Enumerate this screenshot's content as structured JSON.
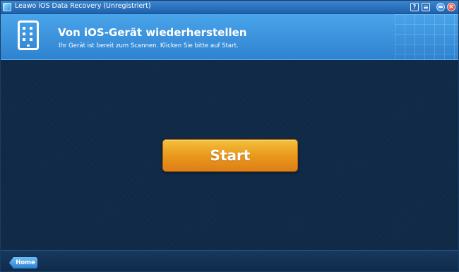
{
  "window": {
    "title": "Leawo iOS Data Recovery (Unregistriert)",
    "controls": {
      "help_label": "?",
      "close_label": "×"
    }
  },
  "header": {
    "title": "Von iOS-Gerät wiederherstellen",
    "subtitle": "Ihr Gerät ist bereit zum Scannen. Klicken Sie bitte auf Start.",
    "icon": "tablet-icon"
  },
  "main": {
    "start_label": "Start"
  },
  "footer": {
    "home_label": "Home"
  },
  "colors": {
    "titlebar": "#2a72c0",
    "header": "#3d95e0",
    "background": "#0f2a48",
    "start_button": "#e8961c",
    "footer": "#13335a",
    "home_button": "#4a9ee4"
  }
}
